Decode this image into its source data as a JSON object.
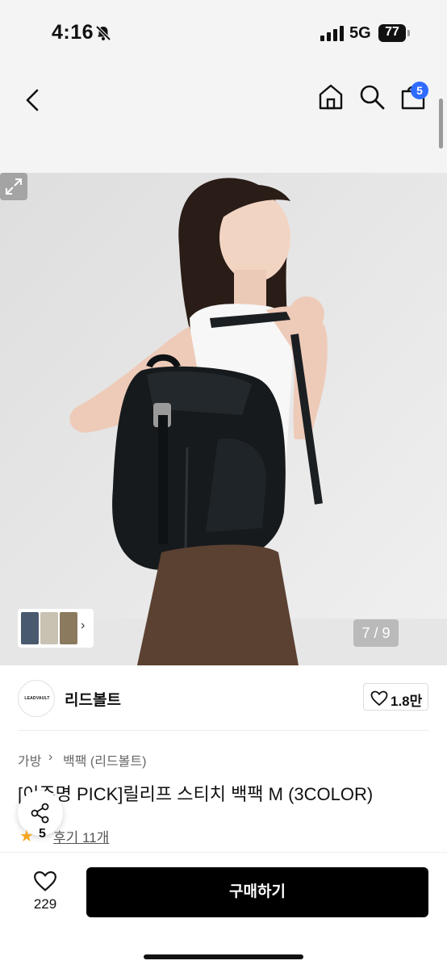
{
  "status_bar": {
    "time": "4:16",
    "network": "5G",
    "battery": "77"
  },
  "nav": {
    "cart_count": "5"
  },
  "hero": {
    "page_counter": "7 / 9"
  },
  "brand": {
    "logo_text": "LEADVAULT",
    "name": "리드볼트",
    "likes": "1.8만"
  },
  "breadcrumb": [
    "가방",
    "백팩 (리드볼트)"
  ],
  "product": {
    "title": "[이주명 PICK]릴리프 스티치 백팩 M (3COLOR)",
    "rating": "5",
    "reviews": "후기 11개"
  },
  "bottom": {
    "wish_count": "229",
    "buy_label": "구매하기"
  },
  "colors": {
    "accent_badge": "#2f6bff",
    "star": "#f5a623",
    "buy_button": "#000000"
  }
}
